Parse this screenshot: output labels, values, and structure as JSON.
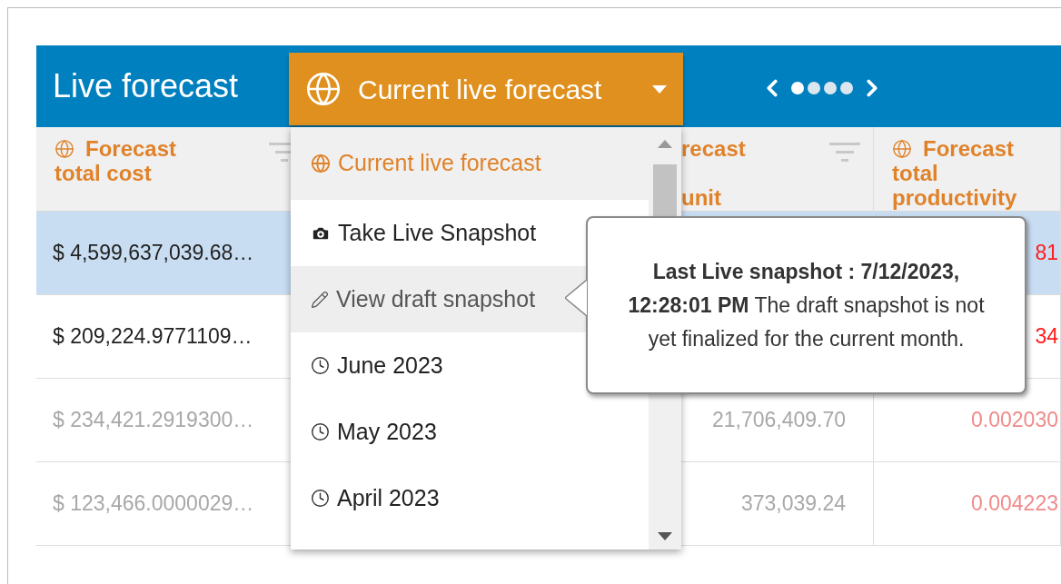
{
  "header": {
    "title": "Live forecast",
    "dropdown": {
      "label": "Current live forecast",
      "expanded": true
    },
    "pager": {
      "dots": [
        {
          "selected": true
        },
        {
          "selected": false
        },
        {
          "selected": false
        },
        {
          "selected": false
        }
      ]
    }
  },
  "dropdown_items": [
    {
      "kind": "live",
      "label": "Current live forecast",
      "selected": true,
      "highlighted": false
    },
    {
      "kind": "snapshot",
      "label": "Take Live Snapshot",
      "selected": false,
      "highlighted": false
    },
    {
      "kind": "draft",
      "label": "View draft snapshot",
      "selected": false,
      "highlighted": true
    },
    {
      "kind": "month",
      "label": "June 2023",
      "selected": false,
      "highlighted": false
    },
    {
      "kind": "month",
      "label": "May 2023",
      "selected": false,
      "highlighted": false
    },
    {
      "kind": "month",
      "label": "April 2023",
      "selected": false,
      "highlighted": false
    }
  ],
  "table": {
    "columns": [
      {
        "heading_lines": [
          "Forecast",
          "total cost"
        ],
        "live": true,
        "filter": true
      },
      {
        "heading_lines": [
          "recast",
          "unit"
        ],
        "live": false,
        "filter": true
      },
      {
        "heading_lines": [
          "Forecast",
          "total",
          "productivity"
        ],
        "live": true
      }
    ],
    "rows": [
      {
        "selected": true,
        "dimmed": false,
        "cells": [
          "$ 4,599,637,039.68…",
          null,
          "81"
        ]
      },
      {
        "selected": false,
        "dimmed": false,
        "cells": [
          "$ 209,224.9771109…",
          null,
          "34"
        ]
      },
      {
        "selected": false,
        "dimmed": true,
        "cells": [
          "$ 234,421.2919300…",
          "21,706,409.70",
          "0.002030"
        ]
      },
      {
        "selected": false,
        "dimmed": true,
        "cells": [
          "$ 123,466.0000029…",
          "373,039.24",
          "0.004223"
        ]
      }
    ]
  },
  "tooltip": {
    "text": "**Last Live snapshot : 7/12/2023, 12:28:01 PM** The draft snapshot is not yet finalized for the current month."
  }
}
